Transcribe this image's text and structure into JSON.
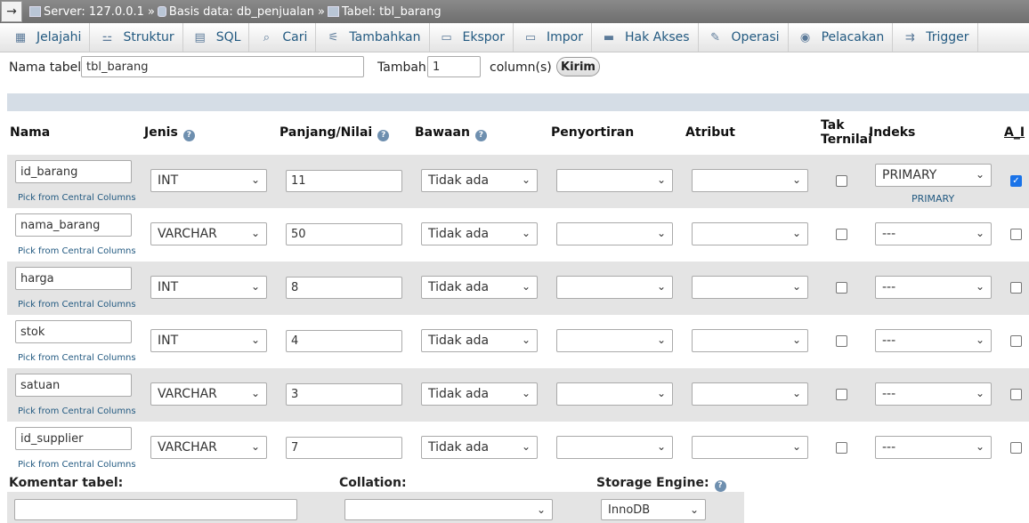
{
  "breadcrumb": {
    "arrow": "→",
    "server": "Server: 127.0.0.1",
    "database": "Basis data: db_penjualan",
    "table": "Tabel: tbl_barang",
    "separator": "»"
  },
  "tabs": [
    {
      "label": "Jelajahi",
      "icon": "browse-icon"
    },
    {
      "label": "Struktur",
      "icon": "structure-icon"
    },
    {
      "label": "SQL",
      "icon": "sql-icon"
    },
    {
      "label": "Cari",
      "icon": "search-icon"
    },
    {
      "label": "Tambahkan",
      "icon": "insert-icon"
    },
    {
      "label": "Ekspor",
      "icon": "export-icon"
    },
    {
      "label": "Impor",
      "icon": "import-icon"
    },
    {
      "label": "Hak Akses",
      "icon": "privileges-icon"
    },
    {
      "label": "Operasi",
      "icon": "wrench-icon"
    },
    {
      "label": "Pelacakan",
      "icon": "eye-icon"
    },
    {
      "label": "Trigger",
      "icon": "trigger-icon"
    }
  ],
  "table_form": {
    "name_label": "Nama tabel:",
    "name_value": "tbl_barang",
    "add_label": "Tambah",
    "add_value": "1",
    "columns_label": "column(s)",
    "submit_label": "Kirim"
  },
  "headers": {
    "name": "Nama",
    "type": "Jenis",
    "length": "Panjang/Nilai",
    "default": "Bawaan",
    "collation": "Penyortiran",
    "attributes": "Atribut",
    "null_line1": "Tak",
    "null_line2": "Ternilai",
    "index": "Indeks",
    "ai": "A_I"
  },
  "pick_label": "Pick from Central Columns",
  "rows": [
    {
      "name": "id_barang",
      "type": "INT",
      "length": "11",
      "default": "Tidak ada",
      "collation": "",
      "attribute": "",
      "null": false,
      "index": "PRIMARY",
      "index_note": "PRIMARY",
      "ai": true
    },
    {
      "name": "nama_barang",
      "type": "VARCHAR",
      "length": "50",
      "default": "Tidak ada",
      "collation": "",
      "attribute": "",
      "null": false,
      "index": "---",
      "index_note": "",
      "ai": false
    },
    {
      "name": "harga",
      "type": "INT",
      "length": "8",
      "default": "Tidak ada",
      "collation": "",
      "attribute": "",
      "null": false,
      "index": "---",
      "index_note": "",
      "ai": false
    },
    {
      "name": "stok",
      "type": "INT",
      "length": "4",
      "default": "Tidak ada",
      "collation": "",
      "attribute": "",
      "null": false,
      "index": "---",
      "index_note": "",
      "ai": false
    },
    {
      "name": "satuan",
      "type": "VARCHAR",
      "length": "3",
      "default": "Tidak ada",
      "collation": "",
      "attribute": "",
      "null": false,
      "index": "---",
      "index_note": "",
      "ai": false
    },
    {
      "name": "id_supplier",
      "type": "VARCHAR",
      "length": "7",
      "default": "Tidak ada",
      "collation": "",
      "attribute": "",
      "null": false,
      "index": "---",
      "index_note": "",
      "ai": false
    }
  ],
  "footer": {
    "comment_label": "Komentar tabel:",
    "comment_value": "",
    "collation_label": "Collation:",
    "collation_value": "",
    "engine_label": "Storage Engine:",
    "engine_value": "InnoDB"
  }
}
